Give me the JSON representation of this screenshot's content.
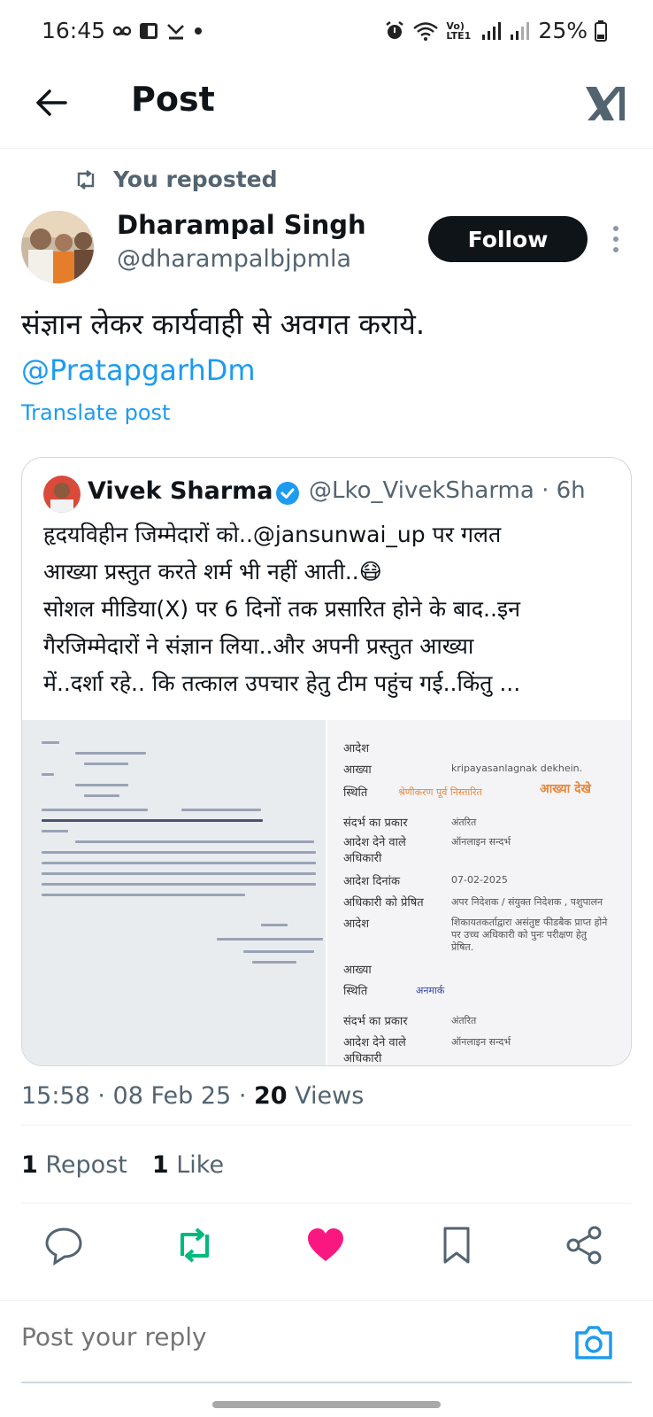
{
  "status_bar": {
    "time": "16:45",
    "network_label": "Vo) LTE1",
    "battery": "25%"
  },
  "header": {
    "title": "Post"
  },
  "repost_context": {
    "text": "You reposted"
  },
  "post": {
    "author_name": "Dharampal Singh",
    "author_handle": "@dharampalbjpmla",
    "follow_label": "Follow",
    "text": "संज्ञान लेकर कार्यवाही से अवगत कराये.",
    "mention": "@PratapgarhDm",
    "translate_label": "Translate post",
    "timestamp": "15:58 · 08 Feb 25 · ",
    "views_count": "20",
    "views_label": " Views",
    "reposts_count": "1",
    "reposts_label": " Repost",
    "likes_count": "1",
    "likes_label": " Like"
  },
  "quoted_post": {
    "author_name": "Vivek Sharma",
    "author_handle": "@Lko_VivekSharma · 6h",
    "text_line1": "हृदयविहीन जिम्मेदारों को..@jansunwai_up पर गलत",
    "text_line2": "आख्या प्रस्तुत करते शर्म भी नहीं आती..😷",
    "text_line3": "सोशल मीडिया(X) पर 6 दिनों तक प्रसारित होने के बाद..इन",
    "text_line4": "गैरजिम्मेदारों ने संज्ञान लिया..और अपनी प्रस्तुत आख्या",
    "text_line5": "में..दर्शा रहे.. कि तत्काल उपचार हेतु टीम पहुंच गई..किंतु ...",
    "portal": {
      "row_aadesh": "आदेश",
      "row_aakhya": "आख्या",
      "val_aakhya": "kripayasanlagnak dekhein.",
      "row_sthiti": "स्थिति",
      "val_sthiti": "श्रेणीकरण पूर्व निस्तारित",
      "view_report": "आख्या देखे",
      "row_sandarbh": "संदर्भ का प्रकार",
      "val_sandarbh": "अंतरित",
      "row_aadesh_dene": "आदेश देने वाले",
      "row_adhikari": "अधिकारी",
      "val_aadesh_dene": "ऑनलाइन सन्दर्भ",
      "row_aadesh_dinank": "आदेश दिनांक",
      "val_aadesh_dinank": "07-02-2025",
      "row_preshit": "अधिकारी को प्रेषित",
      "val_preshit": "अपर निदेशक / संयुक्त निदेशक , पशुपालन",
      "val_aadesh_text": "शिकायतकर्ताद्वारा असंतुष्ट फीडबैक प्राप्त होने पर उच्च अधिकारी को पुनः परीक्षण हेतु प्रेषित.",
      "val_anmark": "अनमार्क",
      "val_sandarbh2": "अंतरित",
      "val_aadesh_dene2": "ऑनलाइन सन्दर्भ"
    }
  },
  "reply": {
    "placeholder": "Post your reply"
  },
  "colors": {
    "accent": "#1d9bf0",
    "repost_green": "#00ba7c",
    "like_pink": "#f91880",
    "text_primary": "#0f1419",
    "text_secondary": "#536471"
  },
  "icons": {
    "back": "arrow-left-icon",
    "brand": "x-logo-icon",
    "repost_context": "repost-icon",
    "more": "more-vertical-icon",
    "verified": "verified-badge-icon",
    "reply": "reply-icon",
    "repost": "repost-icon",
    "like": "heart-icon",
    "bookmark": "bookmark-icon",
    "share": "share-icon",
    "camera": "camera-icon"
  }
}
